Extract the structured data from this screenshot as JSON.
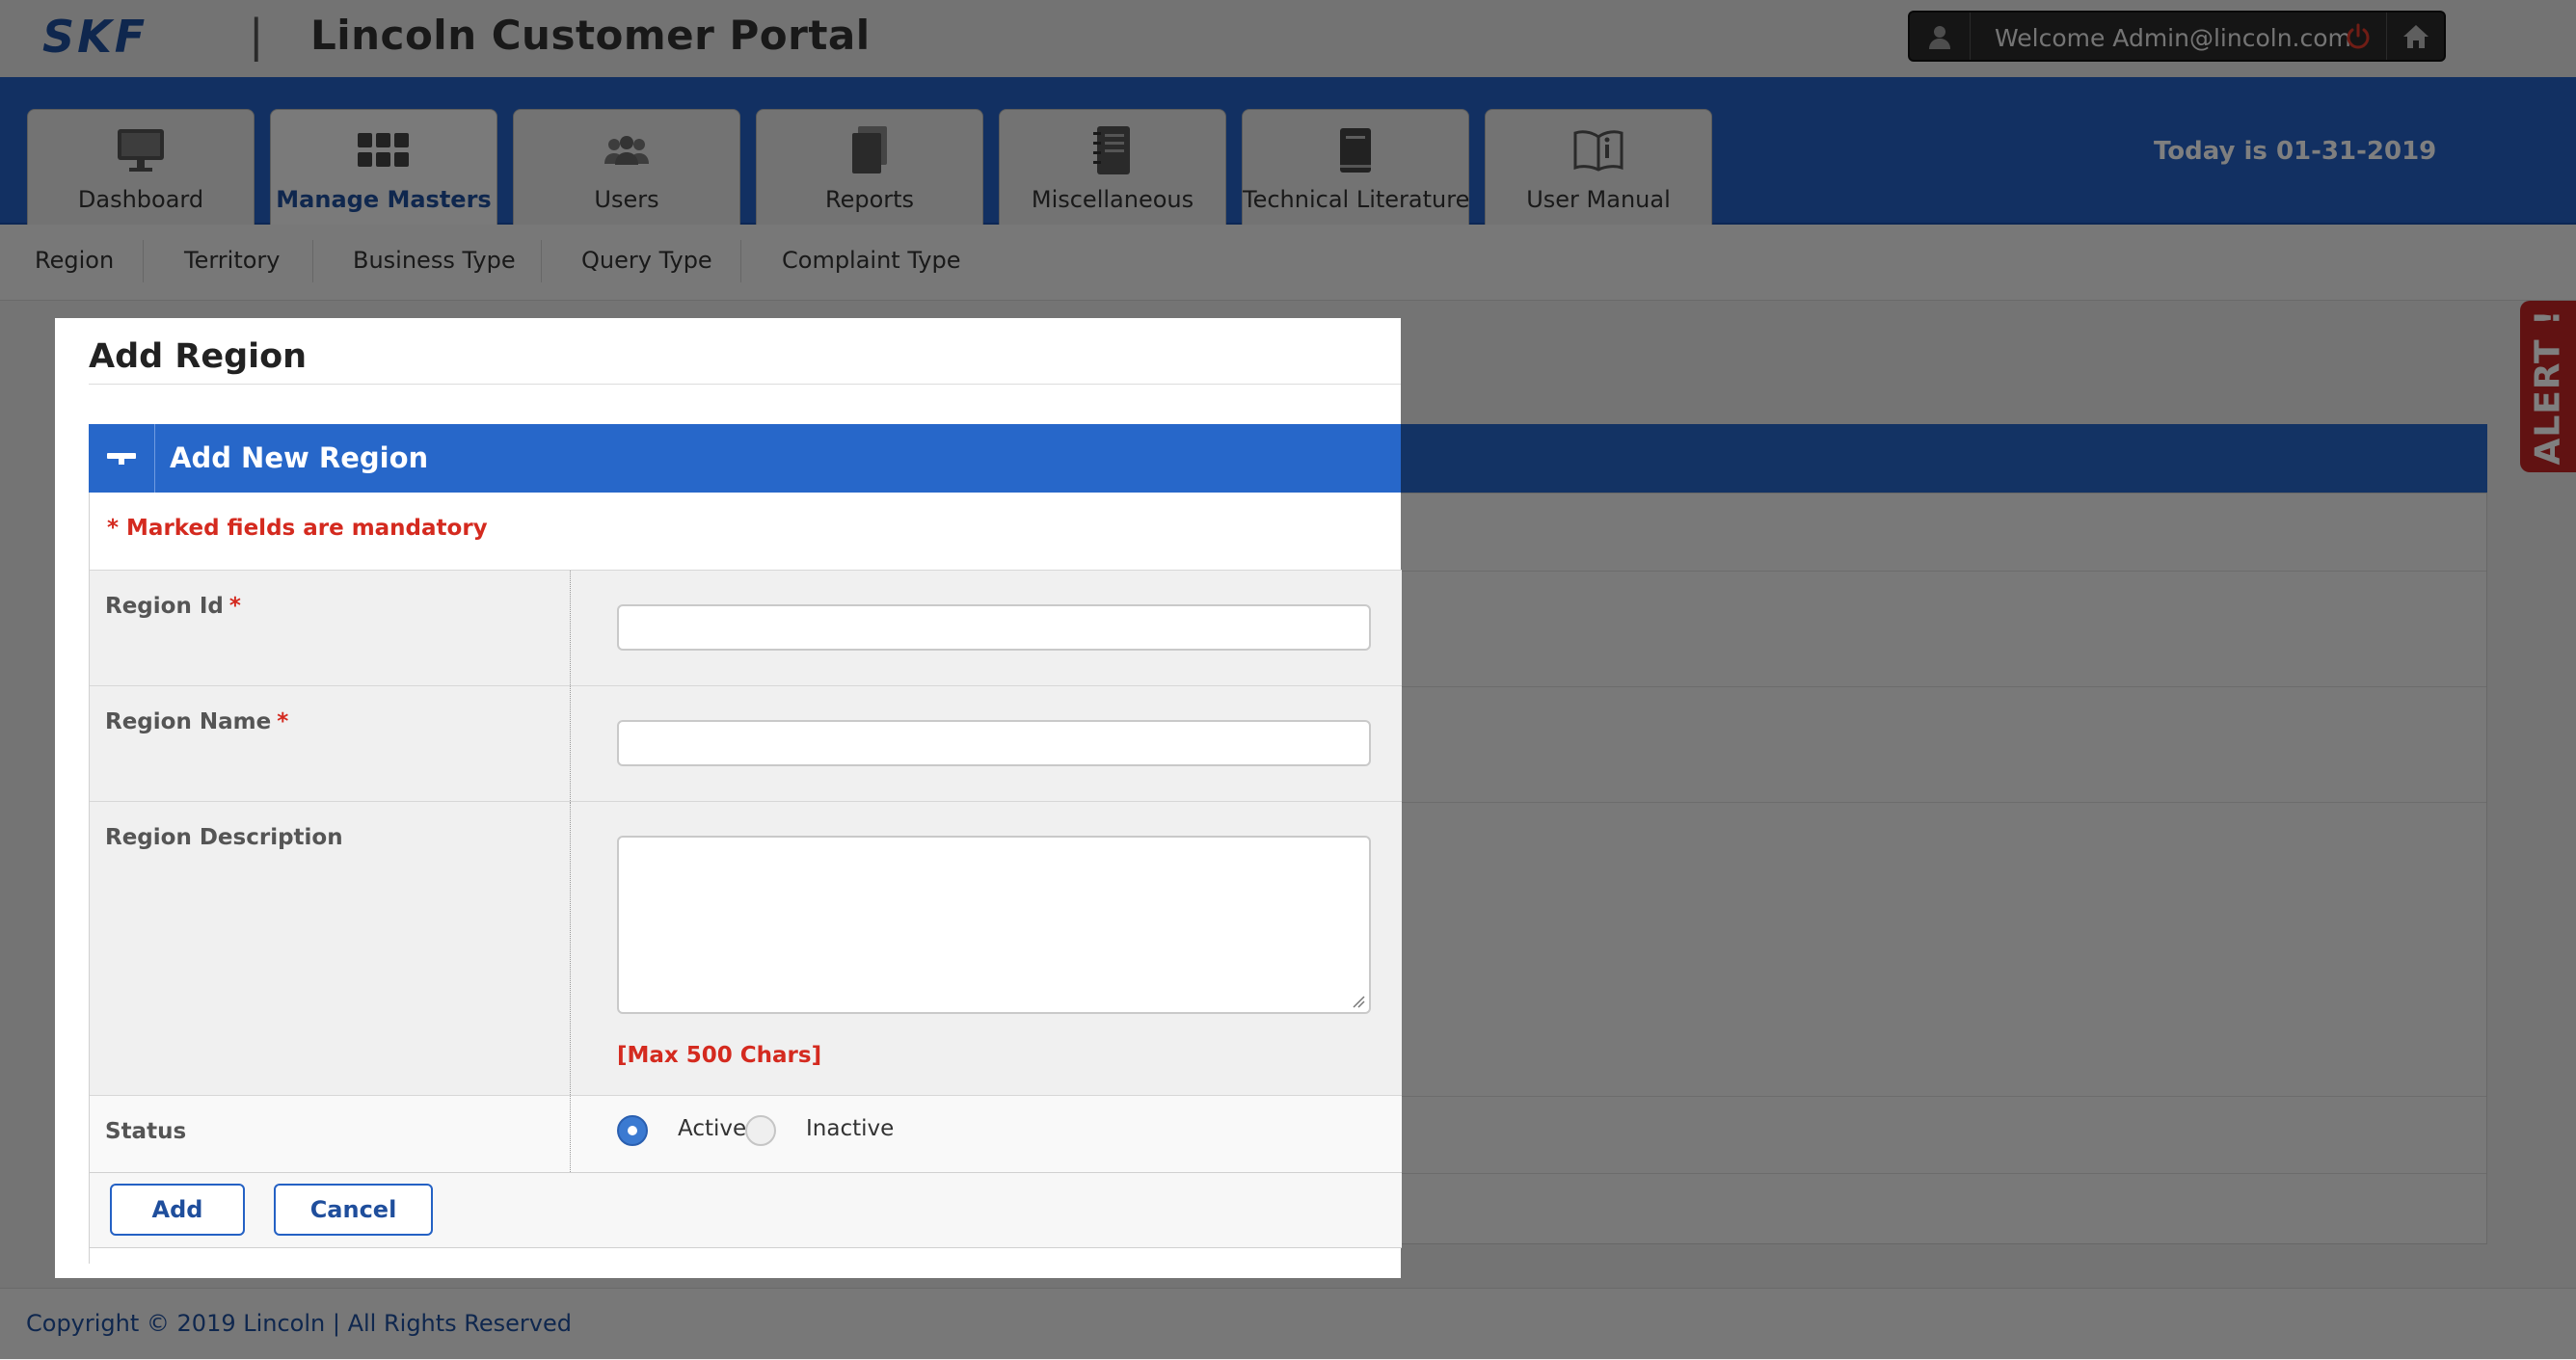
{
  "header": {
    "brand": "SKF",
    "separator": "|",
    "app_title": "Lincoln Customer Portal",
    "welcome": "Welcome Admin@lincoln.com",
    "today": "Today is 01-31-2019"
  },
  "tabs": [
    {
      "label": "Dashboard",
      "icon": "monitor-icon"
    },
    {
      "label": "Manage Masters",
      "icon": "grid-icon",
      "active": true
    },
    {
      "label": "Users",
      "icon": "users-icon"
    },
    {
      "label": "Reports",
      "icon": "reports-icon"
    },
    {
      "label": "Miscellaneous",
      "icon": "notebook-icon"
    },
    {
      "label": "Technical Literature",
      "icon": "book-icon"
    },
    {
      "label": "User Manual",
      "icon": "open-book-icon"
    }
  ],
  "subnav": [
    "Region",
    "Territory",
    "Business Type",
    "Query Type",
    "Complaint Type"
  ],
  "alert_tab": "ALERT !",
  "modal": {
    "title": "Add Region",
    "panel_title": "Add New Region",
    "mandatory_note": "* Marked fields are mandatory",
    "fields": {
      "region_id_label": "Region Id",
      "region_name_label": "Region Name",
      "region_description_label": "Region Description",
      "max_chars": "[Max 500 Chars]",
      "status_label": "Status",
      "status_options": [
        "Active",
        "Inactive"
      ],
      "status_selected": "Active"
    },
    "required_marker": "*",
    "add_label": "Add",
    "cancel_label": "Cancel"
  },
  "footer": "Copyright © 2019 Lincoln | All Rights Reserved",
  "colors": {
    "nav_blue": "#2461c4",
    "panel_blue": "#2767c9",
    "mandatory_red": "#d42a1f",
    "alert_red": "#c22525"
  }
}
